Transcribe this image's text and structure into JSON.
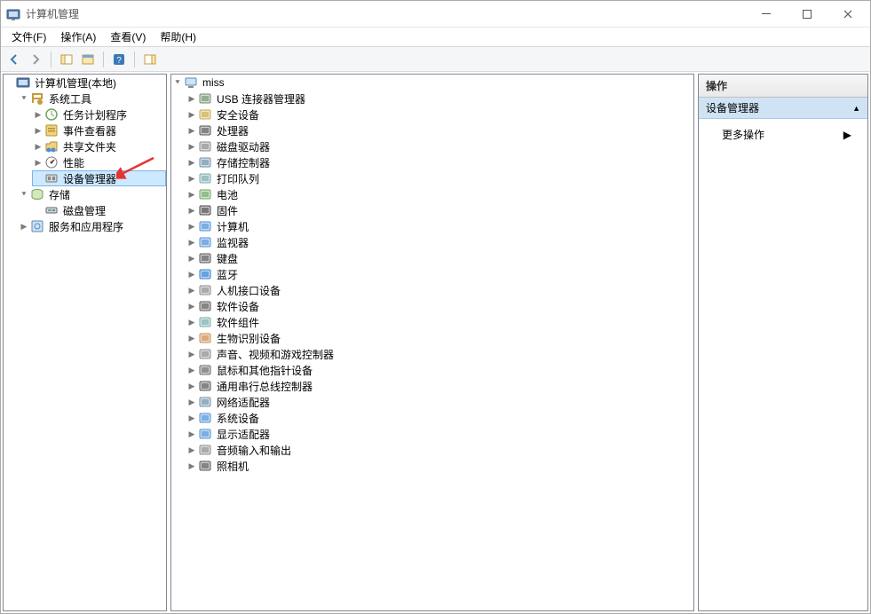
{
  "title": "计算机管理",
  "menu": {
    "file": "文件(F)",
    "action": "操作(A)",
    "view": "查看(V)",
    "help": "帮助(H)"
  },
  "left_tree": {
    "root": "计算机管理(本地)",
    "system_tools": "系统工具",
    "task_scheduler": "任务计划程序",
    "event_viewer": "事件查看器",
    "shared_folders": "共享文件夹",
    "performance": "性能",
    "device_manager": "设备管理器",
    "storage": "存储",
    "disk_management": "磁盘管理",
    "services_apps": "服务和应用程序"
  },
  "device_root": "miss",
  "devices": [
    {
      "id": "usb-connector-manager",
      "label": "USB 连接器管理器"
    },
    {
      "id": "security-devices",
      "label": "安全设备"
    },
    {
      "id": "processors",
      "label": "处理器"
    },
    {
      "id": "disk-drives",
      "label": "磁盘驱动器"
    },
    {
      "id": "storage-controllers",
      "label": "存储控制器"
    },
    {
      "id": "print-queues",
      "label": "打印队列"
    },
    {
      "id": "batteries",
      "label": "电池"
    },
    {
      "id": "firmware",
      "label": "固件"
    },
    {
      "id": "computer",
      "label": "计算机"
    },
    {
      "id": "monitors",
      "label": "监视器"
    },
    {
      "id": "keyboards",
      "label": "键盘"
    },
    {
      "id": "bluetooth",
      "label": "蓝牙"
    },
    {
      "id": "hid",
      "label": "人机接口设备"
    },
    {
      "id": "software-devices",
      "label": "软件设备"
    },
    {
      "id": "software-components",
      "label": "软件组件"
    },
    {
      "id": "biometric",
      "label": "生物识别设备"
    },
    {
      "id": "sound-video-game",
      "label": "声音、视频和游戏控制器"
    },
    {
      "id": "mouse-pointing",
      "label": "鼠标和其他指针设备"
    },
    {
      "id": "usb-controllers",
      "label": "通用串行总线控制器"
    },
    {
      "id": "network-adapters",
      "label": "网络适配器"
    },
    {
      "id": "system-devices",
      "label": "系统设备"
    },
    {
      "id": "display-adapters",
      "label": "显示适配器"
    },
    {
      "id": "audio-io",
      "label": "音频输入和输出"
    },
    {
      "id": "cameras",
      "label": "照相机"
    }
  ],
  "actions": {
    "header": "操作",
    "selected": "设备管理器",
    "more": "更多操作"
  }
}
